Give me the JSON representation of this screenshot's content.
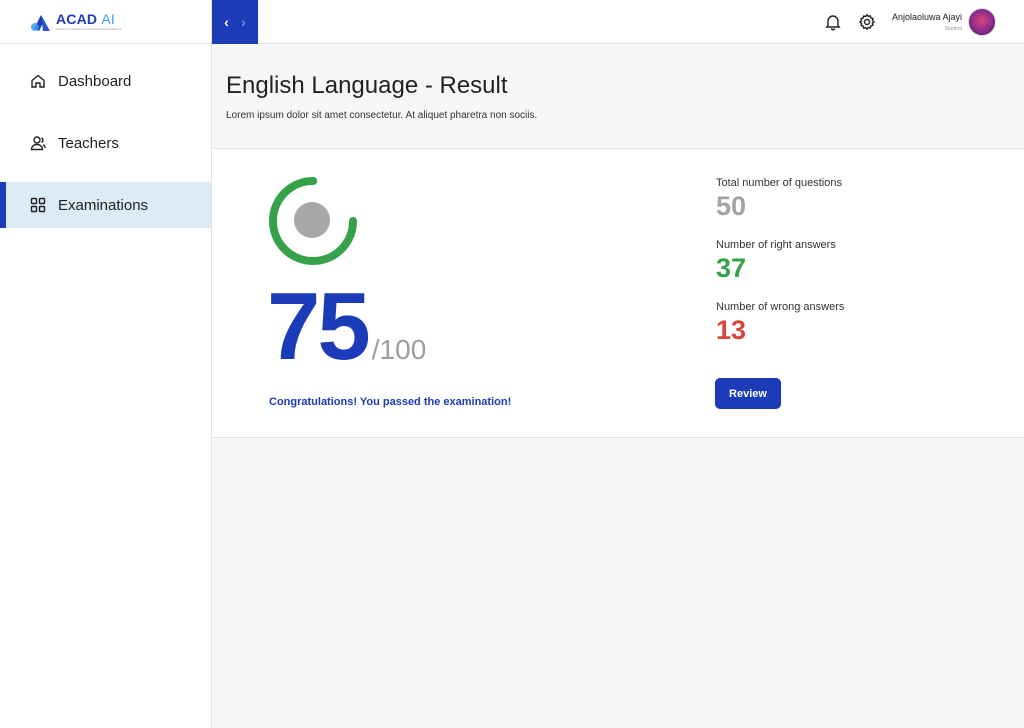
{
  "brand": {
    "name": "ACAD",
    "suffix": "AI",
    "tagline": "Academic Intelligence for Educational Excellence"
  },
  "sidebar": {
    "items": [
      {
        "label": "Dashboard",
        "icon": "home-icon",
        "active": false
      },
      {
        "label": "Teachers",
        "icon": "user-icon",
        "active": false
      },
      {
        "label": "Examinations",
        "icon": "grid-icon",
        "active": true
      }
    ]
  },
  "topbar": {
    "prev_label": "‹",
    "next_label": "›",
    "user": {
      "name": "Anjolaoluwa Ajayi",
      "role": "Student"
    }
  },
  "page": {
    "title": "English Language - Result",
    "subtitle": "Lorem ipsum dolor sit amet consectetur. At aliquet pharetra non sociis."
  },
  "result": {
    "score": "75",
    "score_total": "/100",
    "progress_fraction": 0.75,
    "message": "Congratulations! You passed the examination!",
    "stats": [
      {
        "label": "Total number of questions",
        "value": "50"
      },
      {
        "label": "Number of right answers",
        "value": "37"
      },
      {
        "label": "Number of wrong answers",
        "value": "13"
      }
    ],
    "review_label": "Review"
  },
  "colors": {
    "primary": "#1b3bb8",
    "success": "#35a24a",
    "danger": "#d9453a",
    "muted": "#a3a3a3",
    "active_bg": "#dcebf5"
  }
}
